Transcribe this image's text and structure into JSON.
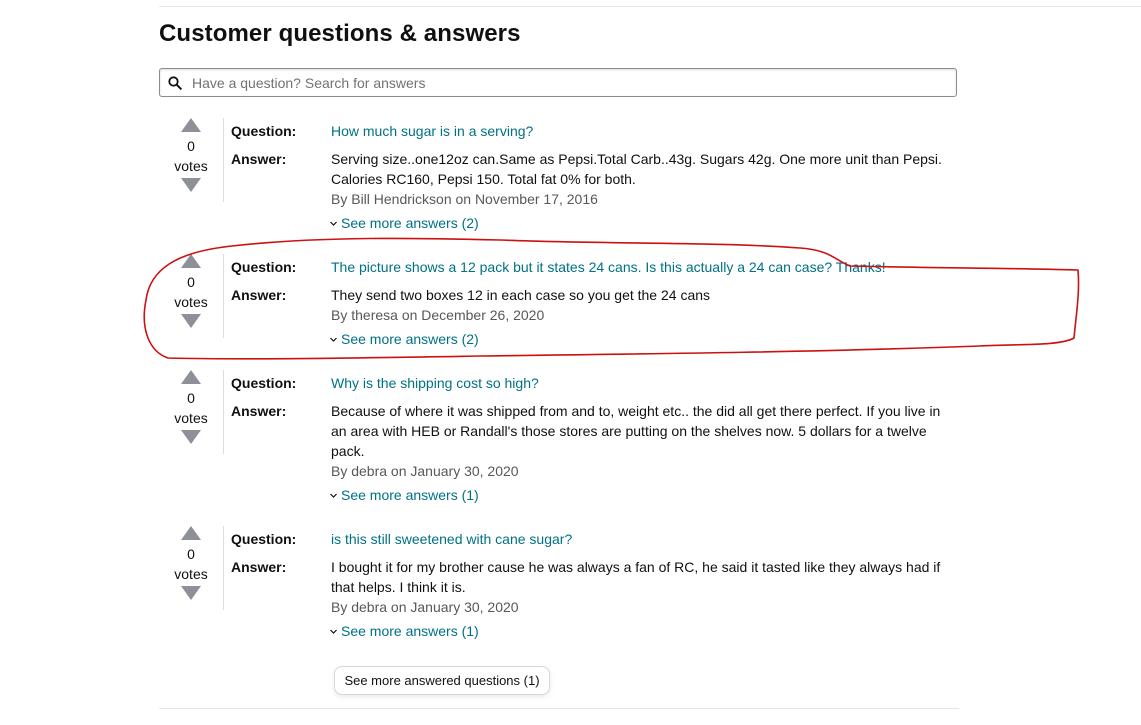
{
  "section": {
    "title": "Customer questions & answers"
  },
  "search": {
    "placeholder": "Have a question? Search for answers",
    "icon": "search-icon"
  },
  "labels": {
    "question": "Question:",
    "answer": "Answer:",
    "votes": "votes"
  },
  "questions": [
    {
      "votes": "0",
      "question": "How much sugar is in a serving?",
      "answer": "Serving size..one12oz can.Same as Pepsi.Total Carb..43g. Sugars 42g. One more unit than Pepsi. Calories RC160, Pepsi 150. Total fat 0% for both.",
      "byline": "By Bill Hendrickson on November 17, 2016",
      "more": "See more answers (2)"
    },
    {
      "votes": "0",
      "question": "The picture shows a 12 pack but it states 24 cans. Is this actually a 24 can case? Thanks!",
      "answer": "They send two boxes 12 in each case so you get the 24 cans",
      "byline": "By theresa on December 26, 2020",
      "more": "See more answers (2)"
    },
    {
      "votes": "0",
      "question": "Why is the shipping cost so high?",
      "answer": "Because of where it was shipped from and to, weight etc.. the did all get there perfect. If you live in an area with HEB or Randall's those stores are putting on the shelves now. 5 dollars for a twelve pack.",
      "byline": "By debra on January 30, 2020",
      "more": "See more answers (1)"
    },
    {
      "votes": "0",
      "question": "is this still sweetened with cane sugar?",
      "answer": "I bought it for my brother cause he was always a fan of RC, he said it tasted like they always had if that helps. I think it is.",
      "byline": "By debra on January 30, 2020",
      "more": "See more answers (1)"
    }
  ],
  "footer": {
    "more_questions": "See more answered questions (1)"
  },
  "colors": {
    "link": "#007185",
    "annotation": "#cc1111"
  }
}
